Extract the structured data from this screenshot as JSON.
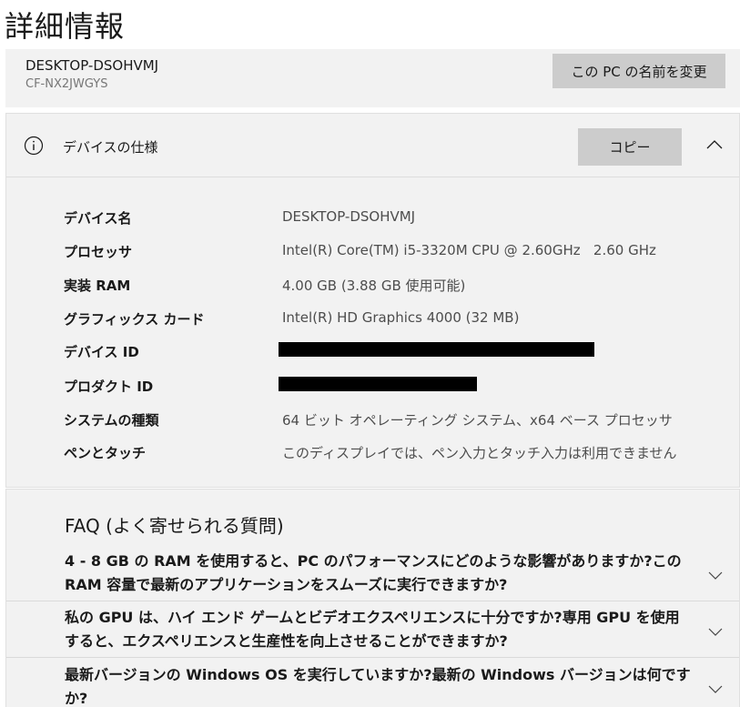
{
  "page": {
    "title": "詳細情報"
  },
  "pc": {
    "name": "DESKTOP-DSOHVMJ",
    "model": "CF-NX2JWGYS",
    "rename_label": "この PC の名前を変更"
  },
  "device_spec": {
    "title": "デバイスの仕様",
    "copy_label": "コピー",
    "icons": {
      "info": "info-circle-icon",
      "collapse": "chevron-up-icon"
    },
    "rows": [
      {
        "label": "デバイス名",
        "value": "DESKTOP-DSOHVMJ",
        "redacted": false
      },
      {
        "label": "プロセッサ",
        "value": "Intel(R) Core(TM) i5-3320M CPU @ 2.60GHz   2.60 GHz",
        "redacted": false
      },
      {
        "label": "実装 RAM",
        "value": "4.00 GB (3.88 GB 使用可能)",
        "redacted": false
      },
      {
        "label": "グラフィックス カード",
        "value": "Intel(R) HD Graphics 4000 (32 MB)",
        "redacted": false
      },
      {
        "label": "デバイス ID",
        "value": "",
        "redacted": true
      },
      {
        "label": "プロダクト ID",
        "value": "",
        "redacted": true
      },
      {
        "label": "システムの種類",
        "value": "64 ビット オペレーティング システム、x64 ベース プロセッサ",
        "redacted": false
      },
      {
        "label": "ペンとタッチ",
        "value": "このディスプレイでは、ペン入力とタッチ入力は利用できません",
        "redacted": false
      }
    ]
  },
  "faq": {
    "title": "FAQ (よく寄せられる質問)",
    "items": [
      "4 - 8 GB の RAM を使用すると、PC のパフォーマンスにどのような影響がありますか?この RAM 容量で最新のアプリケーションをスムーズに実行できますか?",
      "私の GPU は、ハイ エンド ゲームとビデオエクスペリエンスに十分ですか?専用 GPU を使用すると、エクスペリエンスと生産性を向上させることができますか?",
      "最新バージョンの Windows OS を実行していますか?最新の Windows バージョンは何ですか?"
    ],
    "chevron_icon": "chevron-down-icon"
  }
}
